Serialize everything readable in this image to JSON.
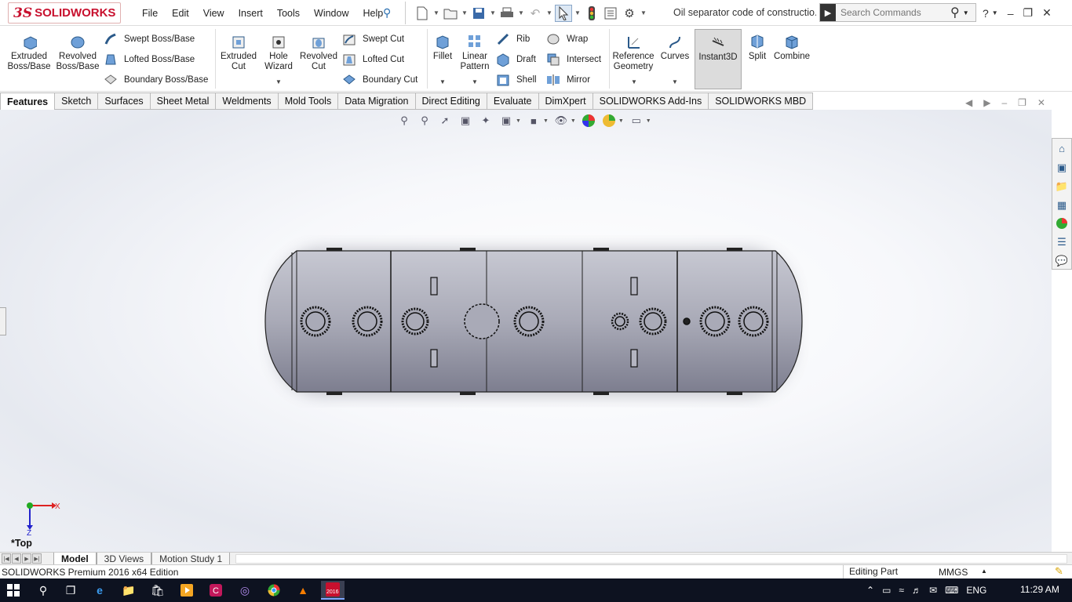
{
  "app": {
    "brand_prefix": "3S",
    "brand": "SOLIDWORKS"
  },
  "menu": [
    "File",
    "Edit",
    "View",
    "Insert",
    "Tools",
    "Window",
    "Help"
  ],
  "document_title": "Oil separator code of constructio...",
  "search": {
    "placeholder": "Search Commands"
  },
  "commands": {
    "extruded_boss": "Extruded Boss/Base",
    "revolved_boss": "Revolved Boss/Base",
    "swept_boss": "Swept Boss/Base",
    "lofted_boss": "Lofted Boss/Base",
    "boundary_boss": "Boundary Boss/Base",
    "extruded_cut": "Extruded Cut",
    "hole_wizard": "Hole Wizard",
    "revolved_cut": "Revolved Cut",
    "swept_cut": "Swept Cut",
    "lofted_cut": "Lofted Cut",
    "boundary_cut": "Boundary Cut",
    "fillet": "Fillet",
    "linear_pattern": "Linear Pattern",
    "rib": "Rib",
    "draft": "Draft",
    "shell": "Shell",
    "wrap": "Wrap",
    "intersect": "Intersect",
    "mirror": "Mirror",
    "reference_geometry": "Reference Geometry",
    "curves": "Curves",
    "instant3d": "Instant3D",
    "split": "Split",
    "combine": "Combine"
  },
  "tabs": [
    "Features",
    "Sketch",
    "Surfaces",
    "Sheet Metal",
    "Weldments",
    "Mold Tools",
    "Data Migration",
    "Direct Editing",
    "Evaluate",
    "DimXpert",
    "SOLIDWORKS Add-Ins",
    "SOLIDWORKS MBD"
  ],
  "active_tab": "Features",
  "view": {
    "name": "*Top",
    "triad_x": "X",
    "triad_z": "Z"
  },
  "bottom_tabs": [
    "Model",
    "3D Views",
    "Motion Study 1"
  ],
  "status": {
    "edition": "SOLIDWORKS Premium 2016 x64 Edition",
    "mode": "Editing Part",
    "units": "MMGS"
  },
  "taskbar": {
    "language": "ENG",
    "time": "11:29 AM",
    "sw_badge": "2016"
  },
  "colors": {
    "brand_red": "#c8102e",
    "tank": "#a8a9b6",
    "tank_dark": "#6e6f80",
    "taskbar": "#0d1220"
  }
}
